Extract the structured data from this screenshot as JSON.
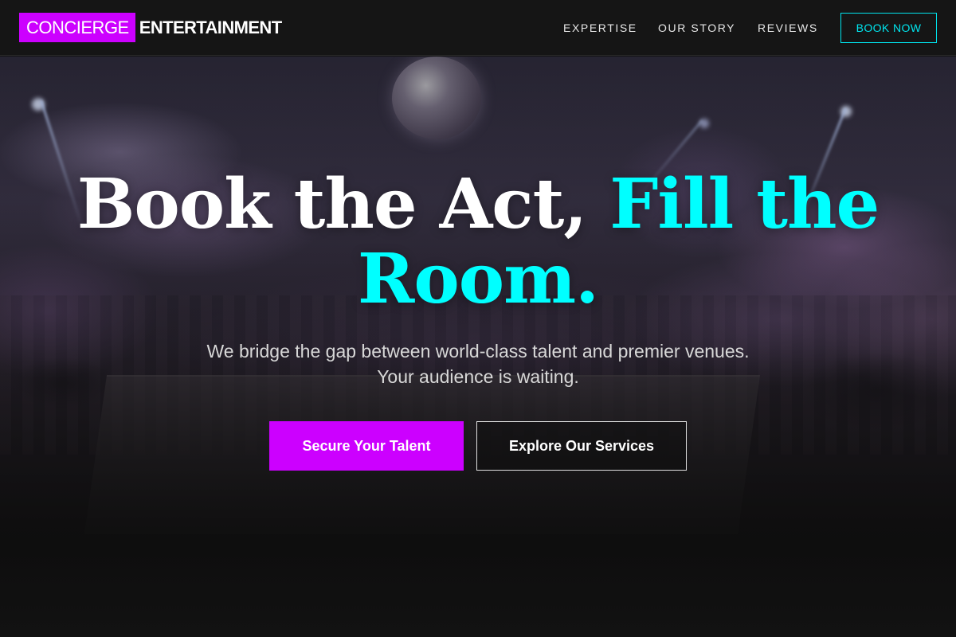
{
  "header": {
    "logo": {
      "highlight": "CONCIERGE",
      "text": "ENTERTAINMENT"
    },
    "nav": [
      {
        "label": "EXPERTISE"
      },
      {
        "label": "OUR STORY"
      },
      {
        "label": "REVIEWS"
      }
    ],
    "cta_label": "BOOK NOW"
  },
  "hero": {
    "background_icon": "nightclub-crowd-image",
    "headline_plain": "Book the Act, ",
    "headline_accent": "Fill the Room.",
    "subtitle": "We bridge the gap between world-class talent and premier venues. Your audience is waiting.",
    "primary_button": "Secure Your Talent",
    "secondary_button": "Explore Our Services"
  },
  "colors": {
    "brand_magenta": "#cc00ff",
    "accent_cyan": "#00ffff",
    "header_bg": "#151515",
    "book_now_border": "#00e5ee"
  }
}
